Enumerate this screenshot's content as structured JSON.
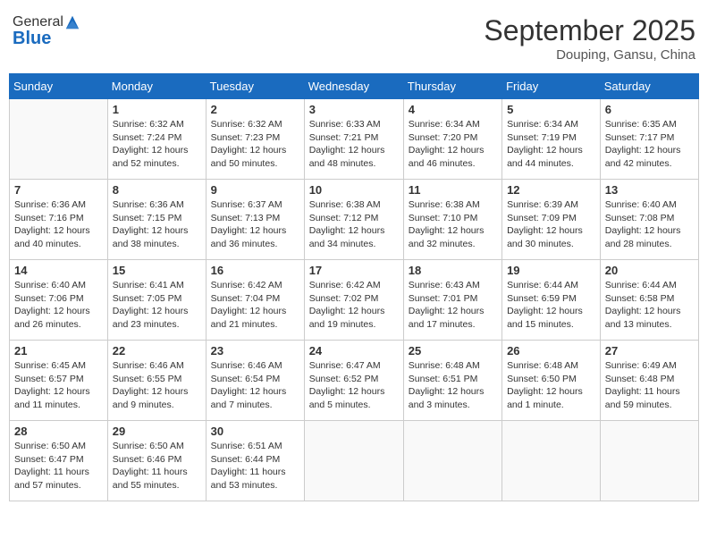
{
  "header": {
    "logo_general": "General",
    "logo_blue": "Blue",
    "month_title": "September 2025",
    "location": "Douping, Gansu, China"
  },
  "weekdays": [
    "Sunday",
    "Monday",
    "Tuesday",
    "Wednesday",
    "Thursday",
    "Friday",
    "Saturday"
  ],
  "weeks": [
    [
      {
        "day": "",
        "info": ""
      },
      {
        "day": "1",
        "info": "Sunrise: 6:32 AM\nSunset: 7:24 PM\nDaylight: 12 hours\nand 52 minutes."
      },
      {
        "day": "2",
        "info": "Sunrise: 6:32 AM\nSunset: 7:23 PM\nDaylight: 12 hours\nand 50 minutes."
      },
      {
        "day": "3",
        "info": "Sunrise: 6:33 AM\nSunset: 7:21 PM\nDaylight: 12 hours\nand 48 minutes."
      },
      {
        "day": "4",
        "info": "Sunrise: 6:34 AM\nSunset: 7:20 PM\nDaylight: 12 hours\nand 46 minutes."
      },
      {
        "day": "5",
        "info": "Sunrise: 6:34 AM\nSunset: 7:19 PM\nDaylight: 12 hours\nand 44 minutes."
      },
      {
        "day": "6",
        "info": "Sunrise: 6:35 AM\nSunset: 7:17 PM\nDaylight: 12 hours\nand 42 minutes."
      }
    ],
    [
      {
        "day": "7",
        "info": "Sunrise: 6:36 AM\nSunset: 7:16 PM\nDaylight: 12 hours\nand 40 minutes."
      },
      {
        "day": "8",
        "info": "Sunrise: 6:36 AM\nSunset: 7:15 PM\nDaylight: 12 hours\nand 38 minutes."
      },
      {
        "day": "9",
        "info": "Sunrise: 6:37 AM\nSunset: 7:13 PM\nDaylight: 12 hours\nand 36 minutes."
      },
      {
        "day": "10",
        "info": "Sunrise: 6:38 AM\nSunset: 7:12 PM\nDaylight: 12 hours\nand 34 minutes."
      },
      {
        "day": "11",
        "info": "Sunrise: 6:38 AM\nSunset: 7:10 PM\nDaylight: 12 hours\nand 32 minutes."
      },
      {
        "day": "12",
        "info": "Sunrise: 6:39 AM\nSunset: 7:09 PM\nDaylight: 12 hours\nand 30 minutes."
      },
      {
        "day": "13",
        "info": "Sunrise: 6:40 AM\nSunset: 7:08 PM\nDaylight: 12 hours\nand 28 minutes."
      }
    ],
    [
      {
        "day": "14",
        "info": "Sunrise: 6:40 AM\nSunset: 7:06 PM\nDaylight: 12 hours\nand 26 minutes."
      },
      {
        "day": "15",
        "info": "Sunrise: 6:41 AM\nSunset: 7:05 PM\nDaylight: 12 hours\nand 23 minutes."
      },
      {
        "day": "16",
        "info": "Sunrise: 6:42 AM\nSunset: 7:04 PM\nDaylight: 12 hours\nand 21 minutes."
      },
      {
        "day": "17",
        "info": "Sunrise: 6:42 AM\nSunset: 7:02 PM\nDaylight: 12 hours\nand 19 minutes."
      },
      {
        "day": "18",
        "info": "Sunrise: 6:43 AM\nSunset: 7:01 PM\nDaylight: 12 hours\nand 17 minutes."
      },
      {
        "day": "19",
        "info": "Sunrise: 6:44 AM\nSunset: 6:59 PM\nDaylight: 12 hours\nand 15 minutes."
      },
      {
        "day": "20",
        "info": "Sunrise: 6:44 AM\nSunset: 6:58 PM\nDaylight: 12 hours\nand 13 minutes."
      }
    ],
    [
      {
        "day": "21",
        "info": "Sunrise: 6:45 AM\nSunset: 6:57 PM\nDaylight: 12 hours\nand 11 minutes."
      },
      {
        "day": "22",
        "info": "Sunrise: 6:46 AM\nSunset: 6:55 PM\nDaylight: 12 hours\nand 9 minutes."
      },
      {
        "day": "23",
        "info": "Sunrise: 6:46 AM\nSunset: 6:54 PM\nDaylight: 12 hours\nand 7 minutes."
      },
      {
        "day": "24",
        "info": "Sunrise: 6:47 AM\nSunset: 6:52 PM\nDaylight: 12 hours\nand 5 minutes."
      },
      {
        "day": "25",
        "info": "Sunrise: 6:48 AM\nSunset: 6:51 PM\nDaylight: 12 hours\nand 3 minutes."
      },
      {
        "day": "26",
        "info": "Sunrise: 6:48 AM\nSunset: 6:50 PM\nDaylight: 12 hours\nand 1 minute."
      },
      {
        "day": "27",
        "info": "Sunrise: 6:49 AM\nSunset: 6:48 PM\nDaylight: 11 hours\nand 59 minutes."
      }
    ],
    [
      {
        "day": "28",
        "info": "Sunrise: 6:50 AM\nSunset: 6:47 PM\nDaylight: 11 hours\nand 57 minutes."
      },
      {
        "day": "29",
        "info": "Sunrise: 6:50 AM\nSunset: 6:46 PM\nDaylight: 11 hours\nand 55 minutes."
      },
      {
        "day": "30",
        "info": "Sunrise: 6:51 AM\nSunset: 6:44 PM\nDaylight: 11 hours\nand 53 minutes."
      },
      {
        "day": "",
        "info": ""
      },
      {
        "day": "",
        "info": ""
      },
      {
        "day": "",
        "info": ""
      },
      {
        "day": "",
        "info": ""
      }
    ]
  ]
}
